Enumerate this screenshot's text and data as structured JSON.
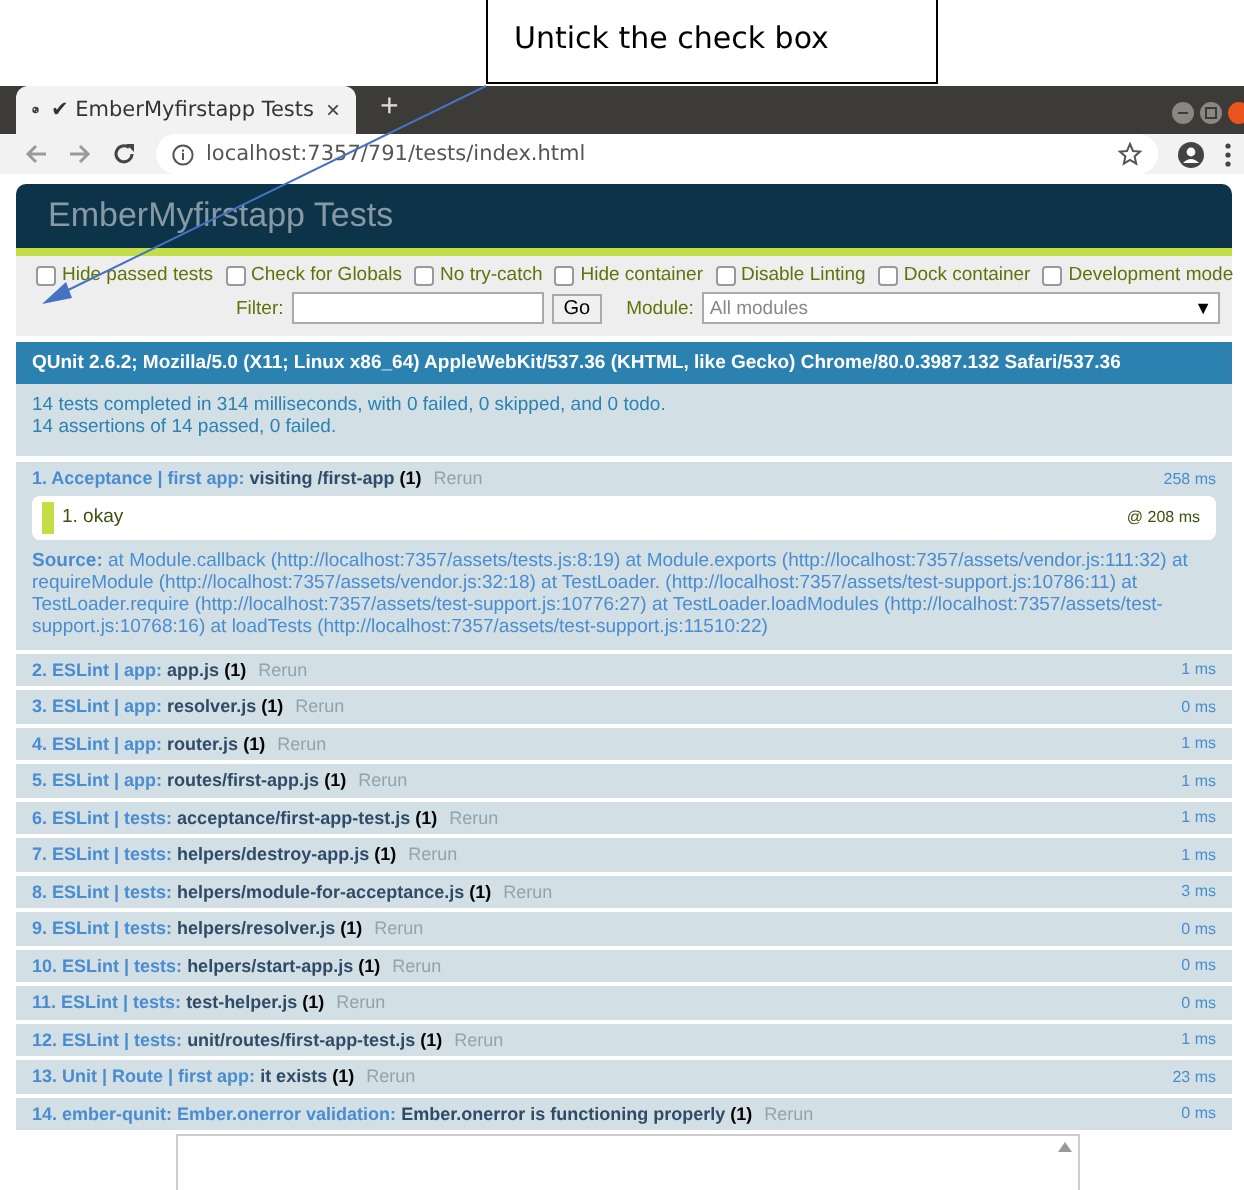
{
  "callout": {
    "text": "Untick the check box"
  },
  "browser": {
    "tab": {
      "title": "✔ EmberMyfirstapp Tests",
      "close": "×",
      "new_tab": "+"
    },
    "address": "localhost:7357/791/tests/index.html"
  },
  "header": {
    "title": "EmberMyfirstapp Tests"
  },
  "options": [
    {
      "label": "Hide passed tests",
      "checked": false
    },
    {
      "label": "Check for Globals",
      "checked": false
    },
    {
      "label": "No try-catch",
      "checked": false
    },
    {
      "label": "Hide container",
      "checked": false
    },
    {
      "label": "Disable Linting",
      "checked": false
    },
    {
      "label": "Dock container",
      "checked": false
    },
    {
      "label": "Development mode",
      "checked": false
    }
  ],
  "filter": {
    "label": "Filter:",
    "button": "Go",
    "module_label": "Module:",
    "module_placeholder": "All modules",
    "caret": "▼"
  },
  "user_agent": "QUnit 2.6.2; Mozilla/5.0 (X11; Linux x86_64) AppleWebKit/537.36 (KHTML, like Gecko) Chrome/80.0.3987.132 Safari/537.36",
  "summary": [
    "14 tests completed in 314 milliseconds, with 0 failed, 0 skipped, and 0 todo.",
    "14 assertions of 14 passed, 0 failed."
  ],
  "tests": [
    {
      "number": "1.",
      "module": "Acceptance | first app:",
      "name": "visiting /first-app",
      "counts": "(1)",
      "rerun": "Rerun",
      "time": "258 ms",
      "expanded": true,
      "assertions": [
        {
          "text": "1. okay",
          "time": "@ 208 ms"
        }
      ],
      "source": {
        "label": "Source:",
        "text": "at Module.callback (http://localhost:7357/assets/tests.js:8:19) at Module.exports (http://localhost:7357/assets/vendor.js:111:32) at requireModule (http://localhost:7357/assets/vendor.js:32:18) at TestLoader. (http://localhost:7357/assets/test-support.js:10786:11) at TestLoader.require (http://localhost:7357/assets/test-support.js:10776:27) at TestLoader.loadModules (http://localhost:7357/assets/test-support.js:10768:16) at loadTests (http://localhost:7357/assets/test-support.js:11510:22)"
      }
    },
    {
      "number": "2.",
      "module": "ESLint | app:",
      "name": "app.js",
      "counts": "(1)",
      "rerun": "Rerun",
      "time": "1 ms",
      "expanded": false
    },
    {
      "number": "3.",
      "module": "ESLint | app:",
      "name": "resolver.js",
      "counts": "(1)",
      "rerun": "Rerun",
      "time": "0 ms",
      "expanded": false
    },
    {
      "number": "4.",
      "module": "ESLint | app:",
      "name": "router.js",
      "counts": "(1)",
      "rerun": "Rerun",
      "time": "1 ms",
      "expanded": false
    },
    {
      "number": "5.",
      "module": "ESLint | app:",
      "name": "routes/first-app.js",
      "counts": "(1)",
      "rerun": "Rerun",
      "time": "1 ms",
      "expanded": false
    },
    {
      "number": "6.",
      "module": "ESLint | tests:",
      "name": "acceptance/first-app-test.js",
      "counts": "(1)",
      "rerun": "Rerun",
      "time": "1 ms",
      "expanded": false
    },
    {
      "number": "7.",
      "module": "ESLint | tests:",
      "name": "helpers/destroy-app.js",
      "counts": "(1)",
      "rerun": "Rerun",
      "time": "1 ms",
      "expanded": false
    },
    {
      "number": "8.",
      "module": "ESLint | tests:",
      "name": "helpers/module-for-acceptance.js",
      "counts": "(1)",
      "rerun": "Rerun",
      "time": "3 ms",
      "expanded": false
    },
    {
      "number": "9.",
      "module": "ESLint | tests:",
      "name": "helpers/resolver.js",
      "counts": "(1)",
      "rerun": "Rerun",
      "time": "0 ms",
      "expanded": false
    },
    {
      "number": "10.",
      "module": "ESLint | tests:",
      "name": "helpers/start-app.js",
      "counts": "(1)",
      "rerun": "Rerun",
      "time": "0 ms",
      "expanded": false
    },
    {
      "number": "11.",
      "module": "ESLint | tests:",
      "name": "test-helper.js",
      "counts": "(1)",
      "rerun": "Rerun",
      "time": "0 ms",
      "expanded": false
    },
    {
      "number": "12.",
      "module": "ESLint | tests:",
      "name": "unit/routes/first-app-test.js",
      "counts": "(1)",
      "rerun": "Rerun",
      "time": "1 ms",
      "expanded": false
    },
    {
      "number": "13.",
      "module": "Unit | Route | first app:",
      "name": "it exists",
      "counts": "(1)",
      "rerun": "Rerun",
      "time": "23 ms",
      "expanded": false
    },
    {
      "number": "14.",
      "module": "ember-qunit: Ember.onerror validation:",
      "name": "Ember.onerror is functioning properly",
      "counts": "(1)",
      "rerun": "Rerun",
      "time": "0 ms",
      "expanded": false
    }
  ]
}
